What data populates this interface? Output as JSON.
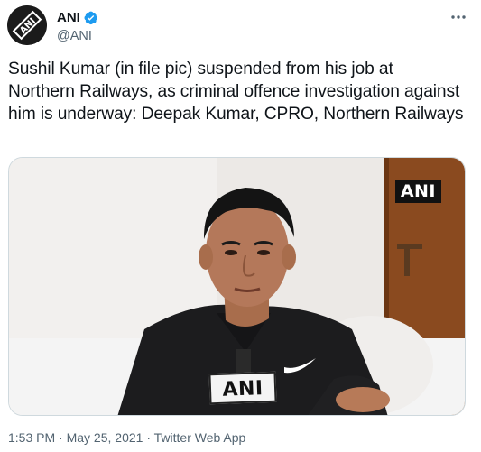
{
  "account": {
    "display_name": "ANI",
    "handle": "@ANI",
    "avatar_logo_text": "ANI",
    "verified": true
  },
  "tweet": {
    "text": "Sushil Kumar (in file pic) suspended from his job at Northern Railways, as criminal offence investigation against him is underway: Deepak Kumar, CPRO, Northern Railways"
  },
  "media": {
    "watermark": "ANI",
    "microphone_label": "ANI"
  },
  "meta": {
    "time": "1:53 PM",
    "separator": "·",
    "date": "May 25, 2021",
    "source": "Twitter Web App"
  },
  "icons": {
    "avatar": "ani-logo-icon",
    "verified": "verified-badge-icon",
    "more": "more-options-icon"
  },
  "colors": {
    "text_primary": "#0f1419",
    "text_secondary": "#536471",
    "verified_blue": "#1d9bf0",
    "border": "#cfd9de"
  }
}
